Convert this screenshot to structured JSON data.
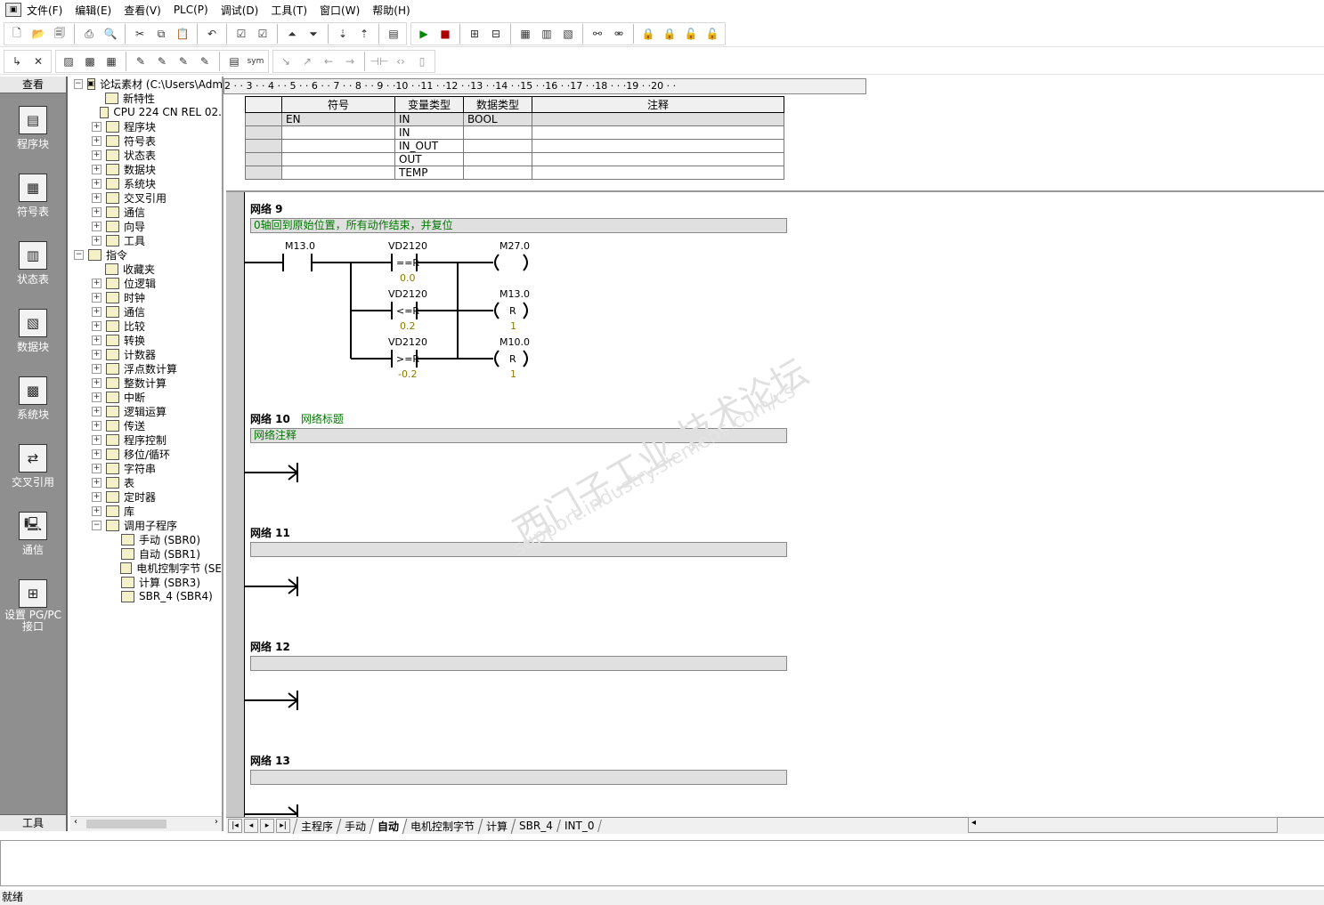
{
  "menubar": [
    "文件(F)",
    "编辑(E)",
    "查看(V)",
    "PLC(P)",
    "调试(D)",
    "工具(T)",
    "窗口(W)",
    "帮助(H)"
  ],
  "leftbar": {
    "header": "查看",
    "footer": "工具",
    "items": [
      "程序块",
      "符号表",
      "状态表",
      "数据块",
      "系统块",
      "交叉引用",
      "通信",
      "设置 PG/PC 接口"
    ]
  },
  "tree": {
    "root": "论坛素材 (C:\\Users\\Admir",
    "items": [
      {
        "label": "新特性",
        "indent": 1,
        "pm": ""
      },
      {
        "label": "CPU 224   CN REL 02.",
        "indent": 1,
        "pm": ""
      },
      {
        "label": "程序块",
        "indent": 1,
        "pm": "+"
      },
      {
        "label": "符号表",
        "indent": 1,
        "pm": "+"
      },
      {
        "label": "状态表",
        "indent": 1,
        "pm": "+"
      },
      {
        "label": "数据块",
        "indent": 1,
        "pm": "+"
      },
      {
        "label": "系统块",
        "indent": 1,
        "pm": "+"
      },
      {
        "label": "交叉引用",
        "indent": 1,
        "pm": "+"
      },
      {
        "label": "通信",
        "indent": 1,
        "pm": "+"
      },
      {
        "label": "向导",
        "indent": 1,
        "pm": "+"
      },
      {
        "label": "工具",
        "indent": 1,
        "pm": "+"
      },
      {
        "label": "指令",
        "indent": 0,
        "pm": "-"
      },
      {
        "label": "收藏夹",
        "indent": 1,
        "pm": ""
      },
      {
        "label": "位逻辑",
        "indent": 1,
        "pm": "+"
      },
      {
        "label": "时钟",
        "indent": 1,
        "pm": "+"
      },
      {
        "label": "通信",
        "indent": 1,
        "pm": "+"
      },
      {
        "label": "比较",
        "indent": 1,
        "pm": "+"
      },
      {
        "label": "转换",
        "indent": 1,
        "pm": "+"
      },
      {
        "label": "计数器",
        "indent": 1,
        "pm": "+"
      },
      {
        "label": "浮点数计算",
        "indent": 1,
        "pm": "+"
      },
      {
        "label": "整数计算",
        "indent": 1,
        "pm": "+"
      },
      {
        "label": "中断",
        "indent": 1,
        "pm": "+"
      },
      {
        "label": "逻辑运算",
        "indent": 1,
        "pm": "+"
      },
      {
        "label": "传送",
        "indent": 1,
        "pm": "+"
      },
      {
        "label": "程序控制",
        "indent": 1,
        "pm": "+"
      },
      {
        "label": "移位/循环",
        "indent": 1,
        "pm": "+"
      },
      {
        "label": "字符串",
        "indent": 1,
        "pm": "+"
      },
      {
        "label": "表",
        "indent": 1,
        "pm": "+"
      },
      {
        "label": "定时器",
        "indent": 1,
        "pm": "+"
      },
      {
        "label": "库",
        "indent": 1,
        "pm": "+"
      },
      {
        "label": "调用子程序",
        "indent": 1,
        "pm": "-"
      },
      {
        "label": "手动 (SBR0)",
        "indent": 2,
        "pm": ""
      },
      {
        "label": "自动 (SBR1)",
        "indent": 2,
        "pm": ""
      },
      {
        "label": "电机控制字节 (SE",
        "indent": 2,
        "pm": ""
      },
      {
        "label": "计算 (SBR3)",
        "indent": 2,
        "pm": ""
      },
      {
        "label": "SBR_4 (SBR4)",
        "indent": 2,
        "pm": ""
      }
    ]
  },
  "ruler": "2 · · 3 · · 4 · · 5 · · 6 · · 7 · · 8 · · 9 · ·10 · ·11 · ·12 · ·13 · ·14 · ·15 · ·16 · ·17 · ·18 · · ·19 · ·20 · ·",
  "vartable": {
    "headers": [
      "",
      "符号",
      "变量类型",
      "数据类型",
      "注释"
    ],
    "rows": [
      [
        "",
        "EN",
        "IN",
        "BOOL",
        ""
      ],
      [
        "",
        "",
        "IN",
        "",
        ""
      ],
      [
        "",
        "",
        "IN_OUT",
        "",
        ""
      ],
      [
        "",
        "",
        "OUT",
        "",
        ""
      ],
      [
        "",
        "",
        "TEMP",
        "",
        ""
      ]
    ]
  },
  "networks": [
    {
      "title": "网络 9",
      "subtitle": "",
      "comment": "0轴回到原始位置，所有动作结束，并复位"
    },
    {
      "title": "网络 10",
      "subtitle": "网络标题",
      "comment": "网络注释"
    },
    {
      "title": "网络 11",
      "subtitle": "",
      "comment": ""
    },
    {
      "title": "网络 12",
      "subtitle": "",
      "comment": ""
    },
    {
      "title": "网络 13",
      "subtitle": "",
      "comment": ""
    }
  ],
  "ladder9": {
    "contact": "M13.0",
    "cmp": [
      {
        "addr": "VD2120",
        "op": "==R",
        "val": "0.0"
      },
      {
        "addr": "VD2120",
        "op": "<=R",
        "val": "0.2"
      },
      {
        "addr": "VD2120",
        "op": ">=R",
        "val": "-0.2"
      }
    ],
    "coils": [
      {
        "addr": "M27.0",
        "type": "",
        "n": ""
      },
      {
        "addr": "M13.0",
        "type": "R",
        "n": "1"
      },
      {
        "addr": "M10.0",
        "type": "R",
        "n": "1"
      }
    ]
  },
  "tabs": [
    "主程序",
    "手动",
    "自动",
    "电机控制字节",
    "计算",
    "SBR_4",
    "INT_0"
  ],
  "active_tab": "自动",
  "status": "就绪",
  "watermark": [
    "西门子工业  技术论坛",
    "support.industry.siemens.com/cs"
  ]
}
